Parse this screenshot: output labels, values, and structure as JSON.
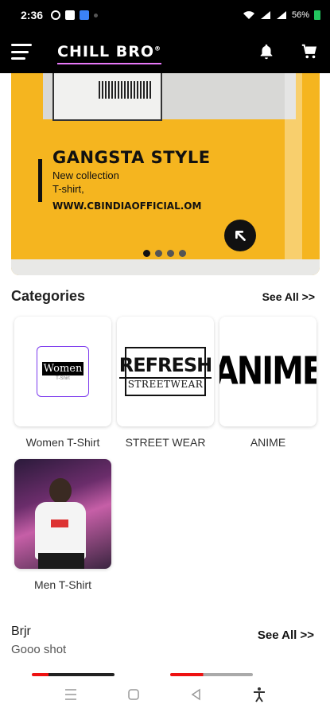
{
  "status_bar": {
    "time": "2:36",
    "battery": "56%"
  },
  "header": {
    "brand": "CHILL BRO",
    "brand_mark": "®",
    "icons": [
      "menu-icon",
      "bell-icon",
      "cart-icon"
    ]
  },
  "banner": {
    "title": "GANGSTA STYLE",
    "line1": "New collection",
    "line2": "T-shirt,",
    "url": "WWW.CBINDIAOFFICIAL.OM",
    "slide_count": 4,
    "active_slide": 1,
    "colors": {
      "background": "#f5b51f",
      "accent": "#111111"
    }
  },
  "categories": {
    "title": "Categories",
    "see_all": "See All >>",
    "items": [
      {
        "label": "Women T-Shirt",
        "logo_text": "Women",
        "logo_sub": "T-Shirt"
      },
      {
        "label": "STREET WEAR",
        "logo_text": "REFRESH",
        "logo_sub": "STREETWEAR"
      },
      {
        "label": "ANIME",
        "logo_text": "ANIME"
      },
      {
        "label": "Men T-Shirt"
      }
    ]
  },
  "collection": {
    "title": "Brjr",
    "subtitle": "Gooo shot",
    "see_all": "See All >>"
  },
  "nav": {
    "icons": [
      "recent-apps-icon",
      "home-icon",
      "back-icon",
      "accessibility-icon"
    ]
  }
}
